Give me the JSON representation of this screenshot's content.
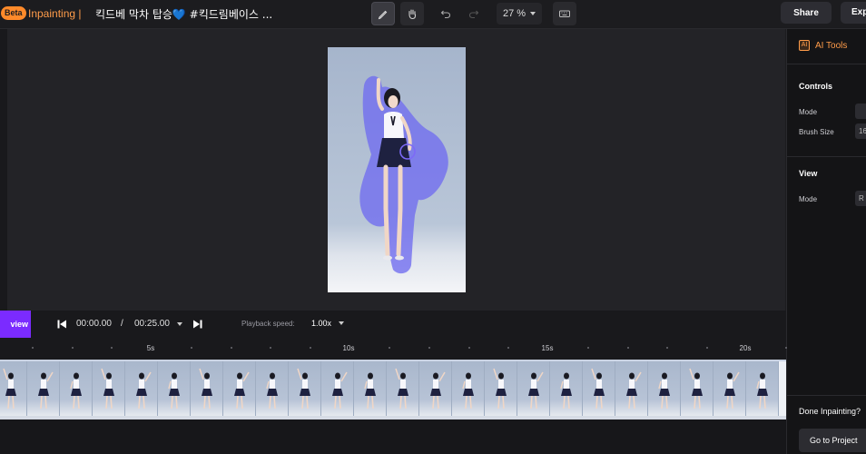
{
  "topbar": {
    "beta_badge": "Beta",
    "mode_title": "Inpainting |",
    "video_title": "킥드베 막차 탑승💙 #킥드림베이스 ...",
    "zoom_value": "27 %",
    "share_label": "Share",
    "export_label": "Exp"
  },
  "sidebar": {
    "ai_badge": "AI",
    "ai_tools_label": "AI Tools",
    "controls_title": "Controls",
    "mode_label": "Mode",
    "brush_size_label": "Brush Size",
    "brush_size_value": "16",
    "view_title": "View",
    "view_mode_label": "Mode",
    "view_mode_value": "R",
    "done_text": "Done Inpainting?",
    "go_to_project_label": "Go to Project"
  },
  "player": {
    "preview_label": "view",
    "current_time": "00:00.00",
    "time_separator": "/",
    "total_time": "00:25.00",
    "playback_speed_label": "Playback speed:",
    "playback_speed_value": "1.00x"
  },
  "timeline": {
    "tick_labels": [
      "5s",
      "10s",
      "15s",
      "20s"
    ]
  },
  "colors": {
    "accent_orange": "#ff9c4a",
    "preview_purple": "#7b2bff",
    "mask_blue": "#6f6cf0"
  },
  "icons": [
    "pen-icon",
    "hand-icon",
    "undo-icon",
    "redo-icon",
    "keyboard-icon",
    "skip-back-icon",
    "skip-forward-icon",
    "caret-down-icon"
  ]
}
